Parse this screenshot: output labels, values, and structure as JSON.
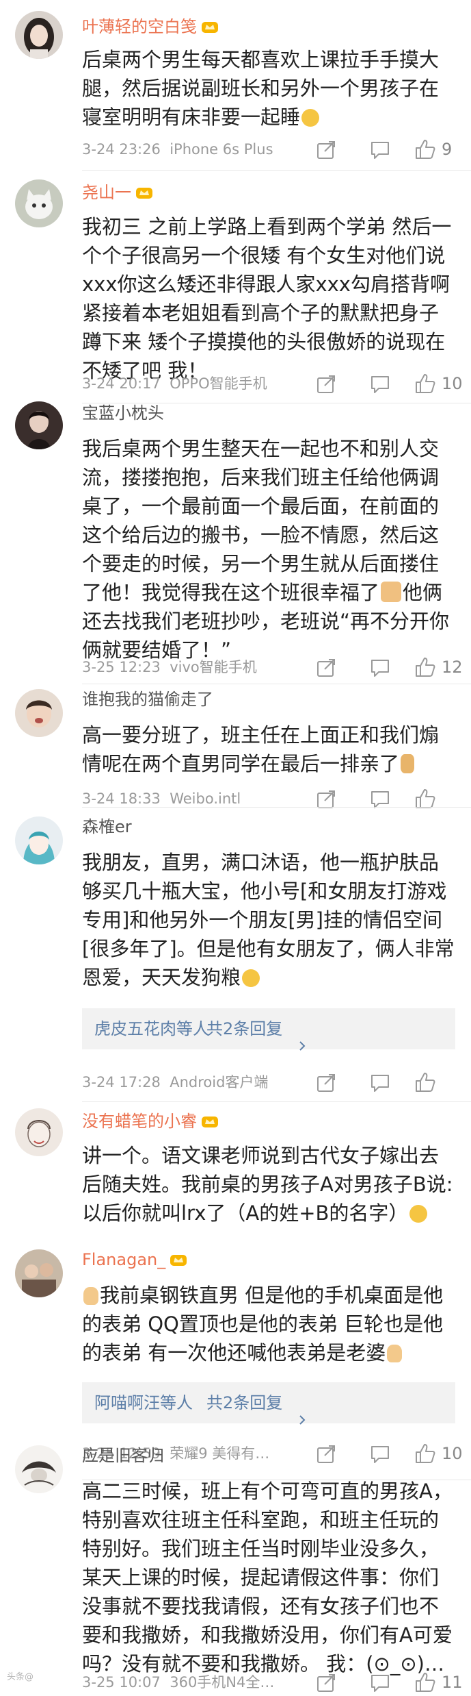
{
  "comments": [
    {
      "user": "叶薄轻的空白笺",
      "vip": true,
      "text": "后桌两个男生每天都喜欢上课拉手手摸大腿，然后据说副班长和另外一个男孩子在寝室明明有床非要一起睡",
      "time": "3-24 23:26",
      "device": "iPhone 6s Plus",
      "likes": "9",
      "avatar_icon": "avatar-girl-dark-hair-icon",
      "emoji": "slightly-smiling-emoji"
    },
    {
      "user": "尧山一",
      "vip": true,
      "text": "我初三 之前上学路上看到两个学弟 然后一个个子很高另一个很矮 有个女生对他们说xxx你这么矮还非得跟人家xxx勾肩搭背啊 紧接着本老姐姐看到高个子的默默把身子蹲下来 矮个子摸摸他的头很傲娇的说现在不矮了吧 我！",
      "time": "3-24 20:17",
      "device": "OPPO智能手机",
      "likes": "10",
      "avatar_icon": "avatar-white-cat-icon"
    },
    {
      "user": "宝蓝小枕头",
      "vip": false,
      "text": "我后桌两个男生整天在一起也不和别人交流，搂搂抱抱，后来我们班主任给他俩调桌了，一个最前面一个最后面，在前面的这个给后边的搬书，一脸不情愿，然后这个要走的时候，另一个男生就从后面搂住了他！我觉得我在这个班很幸福了",
      "text_tail": "他俩还去找我们老班抄吵，老班说“再不分开你俩就要结婚了！”",
      "time": "3-25 12:23",
      "device": "vivo智能手机",
      "likes": "12",
      "avatar_icon": "avatar-dark-portrait-icon",
      "emoji": "cat-emoji"
    },
    {
      "user": "谁抱我的猫偷走了",
      "vip": false,
      "text": "高一要分班了，班主任在上面正和我们煽情呢在两个直男同学在最后一排亲了",
      "time": "3-24 18:33",
      "device": "Weibo.intl",
      "likes": "",
      "avatar_icon": "avatar-child-face-icon",
      "emoji": "praying-emoji"
    },
    {
      "user": "森榷er",
      "vip": false,
      "text": "我朋友，直男，满口沐语，他一瓶护肤品够买几十瓶大宝，他小号[和女朋友打游戏专用]和他另外一个朋友[男]挂的情侣空间[很多年了]。但是他有女朋友了，俩人非常恩爱，天天发狗粮",
      "replies_who": "虎皮五花肉等人",
      "replies_more": "共2条回复",
      "time": "3-24 17:28",
      "device": "Android客户端",
      "likes": "",
      "avatar_icon": "avatar-anime-teal-hair-icon",
      "emoji": "grinning-emoji"
    },
    {
      "user": "没有蜡笔的小睿",
      "vip": true,
      "text": "讲一个。语文课老师说到古代女子嫁出去后随夫姓。我前桌的男孩子A对男孩子B说:以后你就叫lrx了（A的姓+B的名字）",
      "avatar_icon": "avatar-sketch-art-icon",
      "emoji": "grinning-emoji"
    },
    {
      "user": "Flanagan_",
      "vip": true,
      "text": "我前桌钢铁直男 但是他的手机桌面是他的表弟 QQ置顶也是他的表弟 巨轮也是他的表弟 有一次他还喊他表弟是老婆",
      "replies_who": "阿喵啊汪等人",
      "replies_more": "共2条回复",
      "time": "3-25 12:59",
      "device": "荣耀9 美得有…",
      "likes": "10",
      "avatar_icon": "avatar-photo-people-icon",
      "emoji": "thumbs-up-emoji"
    },
    {
      "user": "应是旧客归",
      "vip": false,
      "text": "高二三时候，班上有个可弯可直的男孩A，特别喜欢往班主任科室跑，和班主任玩的特别好。我们班主任当时刚毕业没多久，某天上课的时候，提起请假这件事：你们没事就不要找我请假，还有女孩子们也不要和我撒娇，和我撒娇没用，你们有A可爱吗？没有就不要和我撒娇。 我：(⊙_⊙)…",
      "time": "3-25 10:07",
      "device": "360手机N4全…",
      "likes": "11",
      "avatar_icon": "avatar-ink-drawing-icon"
    }
  ],
  "watermark": "头条@",
  "colors": {
    "vip_name": "#eb7350",
    "link": "#5d7fa8",
    "meta": "#9a9a9a"
  }
}
